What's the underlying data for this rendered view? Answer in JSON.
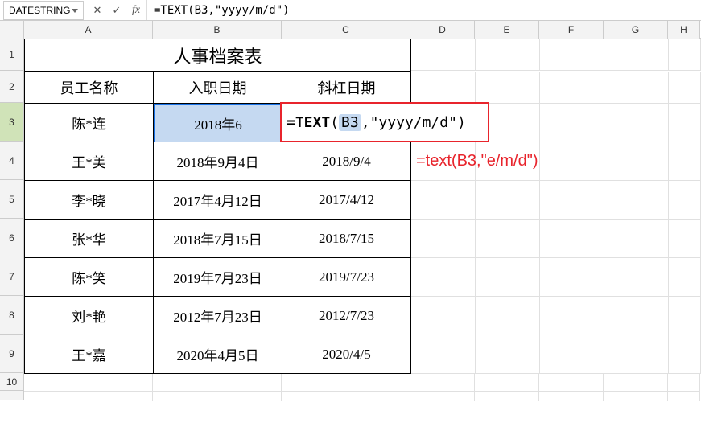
{
  "formula_bar": {
    "name_box": "DATESTRING",
    "formula": "=TEXT(B3,\"yyyy/m/d\")"
  },
  "columns": [
    "A",
    "B",
    "C",
    "D",
    "E",
    "F",
    "G",
    "H"
  ],
  "rows": [
    "1",
    "2",
    "3",
    "4",
    "5",
    "6",
    "7",
    "8",
    "9",
    "10"
  ],
  "title": "人事档案表",
  "headers": {
    "col_a": "员工名称",
    "col_b": "入职日期",
    "col_c": "斜杠日期"
  },
  "editing": {
    "b3_display": "2018年6",
    "formula_prefix_eq": "=",
    "formula_fn": "TEXT",
    "formula_open": "(",
    "formula_ref": "B3",
    "formula_rest": ",\"yyyy/m/d\")"
  },
  "table_rows": [
    {
      "name": "陈*连",
      "date": "2018年6",
      "slash": ""
    },
    {
      "name": "王*美",
      "date": "2018年9月4日",
      "slash": "2018/9/4"
    },
    {
      "name": "李*晓",
      "date": "2017年4月12日",
      "slash": "2017/4/12"
    },
    {
      "name": "张*华",
      "date": "2018年7月15日",
      "slash": "2018/7/15"
    },
    {
      "name": "陈*笑",
      "date": "2019年7月23日",
      "slash": "2019/7/23"
    },
    {
      "name": "刘*艳",
      "date": "2012年7月23日",
      "slash": "2012/7/23"
    },
    {
      "name": "王*嘉",
      "date": "2020年4月5日",
      "slash": "2020/4/5"
    }
  ],
  "annotation": "=text(B3,\"e/m/d\")"
}
